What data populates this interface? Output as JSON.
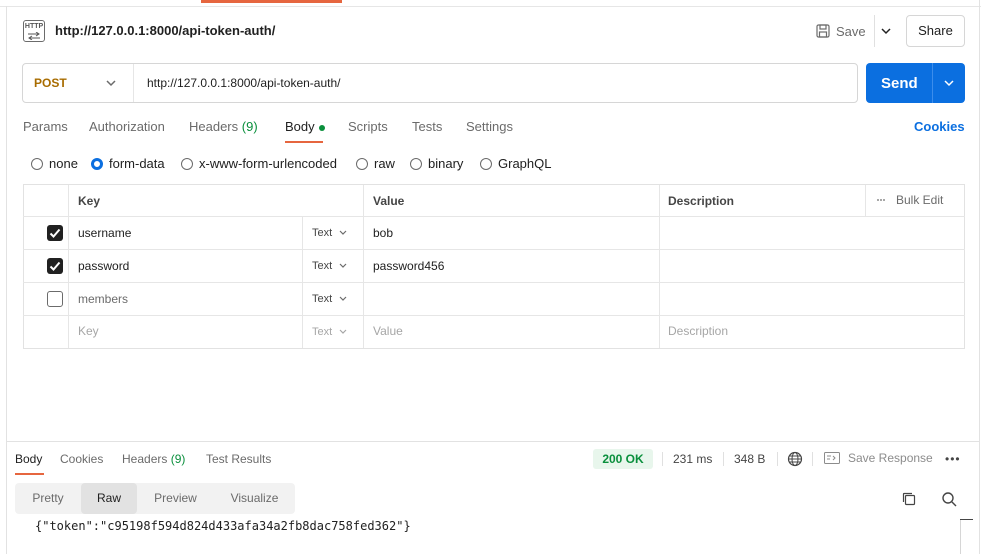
{
  "request": {
    "icon_label": "HTTP",
    "title": "http://127.0.0.1:8000/api-token-auth/",
    "save_label": "Save",
    "share_label": "Share",
    "method": "POST",
    "url": "http://127.0.0.1:8000/api-token-auth/",
    "send_label": "Send"
  },
  "tabs": {
    "params": "Params",
    "authorization": "Authorization",
    "headers": "Headers",
    "headers_count": "(9)",
    "body": "Body",
    "scripts": "Scripts",
    "tests": "Tests",
    "settings": "Settings",
    "cookies": "Cookies"
  },
  "body_types": {
    "none": "none",
    "form_data": "form-data",
    "urlencoded": "x-www-form-urlencoded",
    "raw": "raw",
    "binary": "binary",
    "graphql": "GraphQL",
    "selected": "form-data"
  },
  "table": {
    "headers": {
      "key": "Key",
      "value": "Value",
      "description": "Description",
      "bulk_edit": "Bulk Edit"
    },
    "rows": [
      {
        "checked": true,
        "key": "username",
        "type": "Text",
        "value": "bob",
        "description": ""
      },
      {
        "checked": true,
        "key": "password",
        "type": "Text",
        "value": "password456",
        "description": ""
      },
      {
        "checked": false,
        "key": "members",
        "type": "Text",
        "value": "",
        "description": ""
      }
    ],
    "placeholder": {
      "key": "Key",
      "type": "Text",
      "value": "Value",
      "description": "Description"
    }
  },
  "response": {
    "tabs": {
      "body": "Body",
      "cookies": "Cookies",
      "headers": "Headers",
      "headers_count": "(9)",
      "test_results": "Test Results"
    },
    "status": "200 OK",
    "time": "231 ms",
    "size": "348 B",
    "save_response": "Save Response",
    "views": {
      "pretty": "Pretty",
      "raw": "Raw",
      "preview": "Preview",
      "visualize": "Visualize"
    },
    "raw_body": "{\"token\":\"c95198f594d824d433afa34a2fb8dac758fed362\"}"
  },
  "colors": {
    "accent": "#e6663f",
    "send": "#0b6fe0",
    "method": "#a86c00",
    "status_ok": "#0a8f3c"
  }
}
